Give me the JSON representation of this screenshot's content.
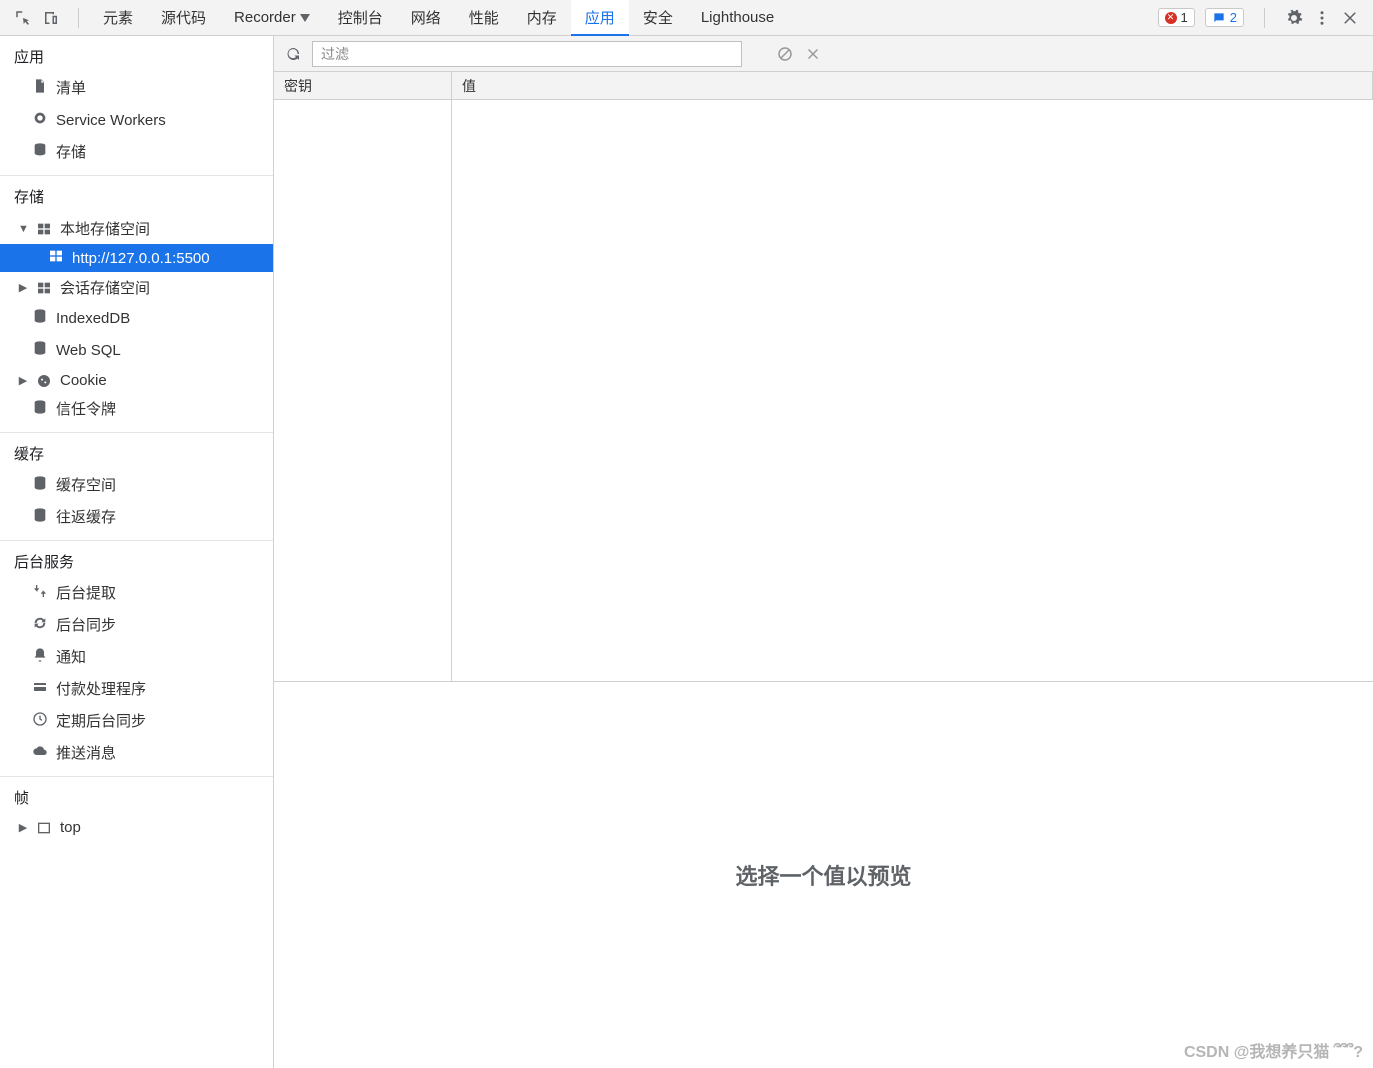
{
  "tabs": {
    "elements": "元素",
    "sources": "源代码",
    "recorder": "Recorder",
    "console": "控制台",
    "network": "网络",
    "performance": "性能",
    "memory": "内存",
    "application": "应用",
    "security": "安全",
    "lighthouse": "Lighthouse"
  },
  "badges": {
    "errors": "1",
    "messages": "2"
  },
  "sidebar": {
    "sections": {
      "app": {
        "title": "应用",
        "manifest": "清单",
        "service_workers": "Service Workers",
        "storage": "存储"
      },
      "storage": {
        "title": "存储",
        "local_storage": "本地存储空间",
        "local_storage_child": "http://127.0.0.1:5500",
        "session_storage": "会话存储空间",
        "indexeddb": "IndexedDB",
        "websql": "Web SQL",
        "cookie": "Cookie",
        "trust_tokens": "信任令牌"
      },
      "cache": {
        "title": "缓存",
        "cache_storage": "缓存空间",
        "bf_cache": "往返缓存"
      },
      "bg": {
        "title": "后台服务",
        "bg_fetch": "后台提取",
        "bg_sync": "后台同步",
        "notifications": "通知",
        "payment": "付款处理程序",
        "periodic_sync": "定期后台同步",
        "push": "推送消息"
      },
      "frames": {
        "title": "帧",
        "top": "top"
      }
    }
  },
  "toolbar": {
    "filter_placeholder": "过滤"
  },
  "grid": {
    "key_header": "密钥",
    "value_header": "值"
  },
  "preview": {
    "empty_text": "选择一个值以预览"
  },
  "watermark": "CSDN @我想养只猫 ՞՞՞?"
}
